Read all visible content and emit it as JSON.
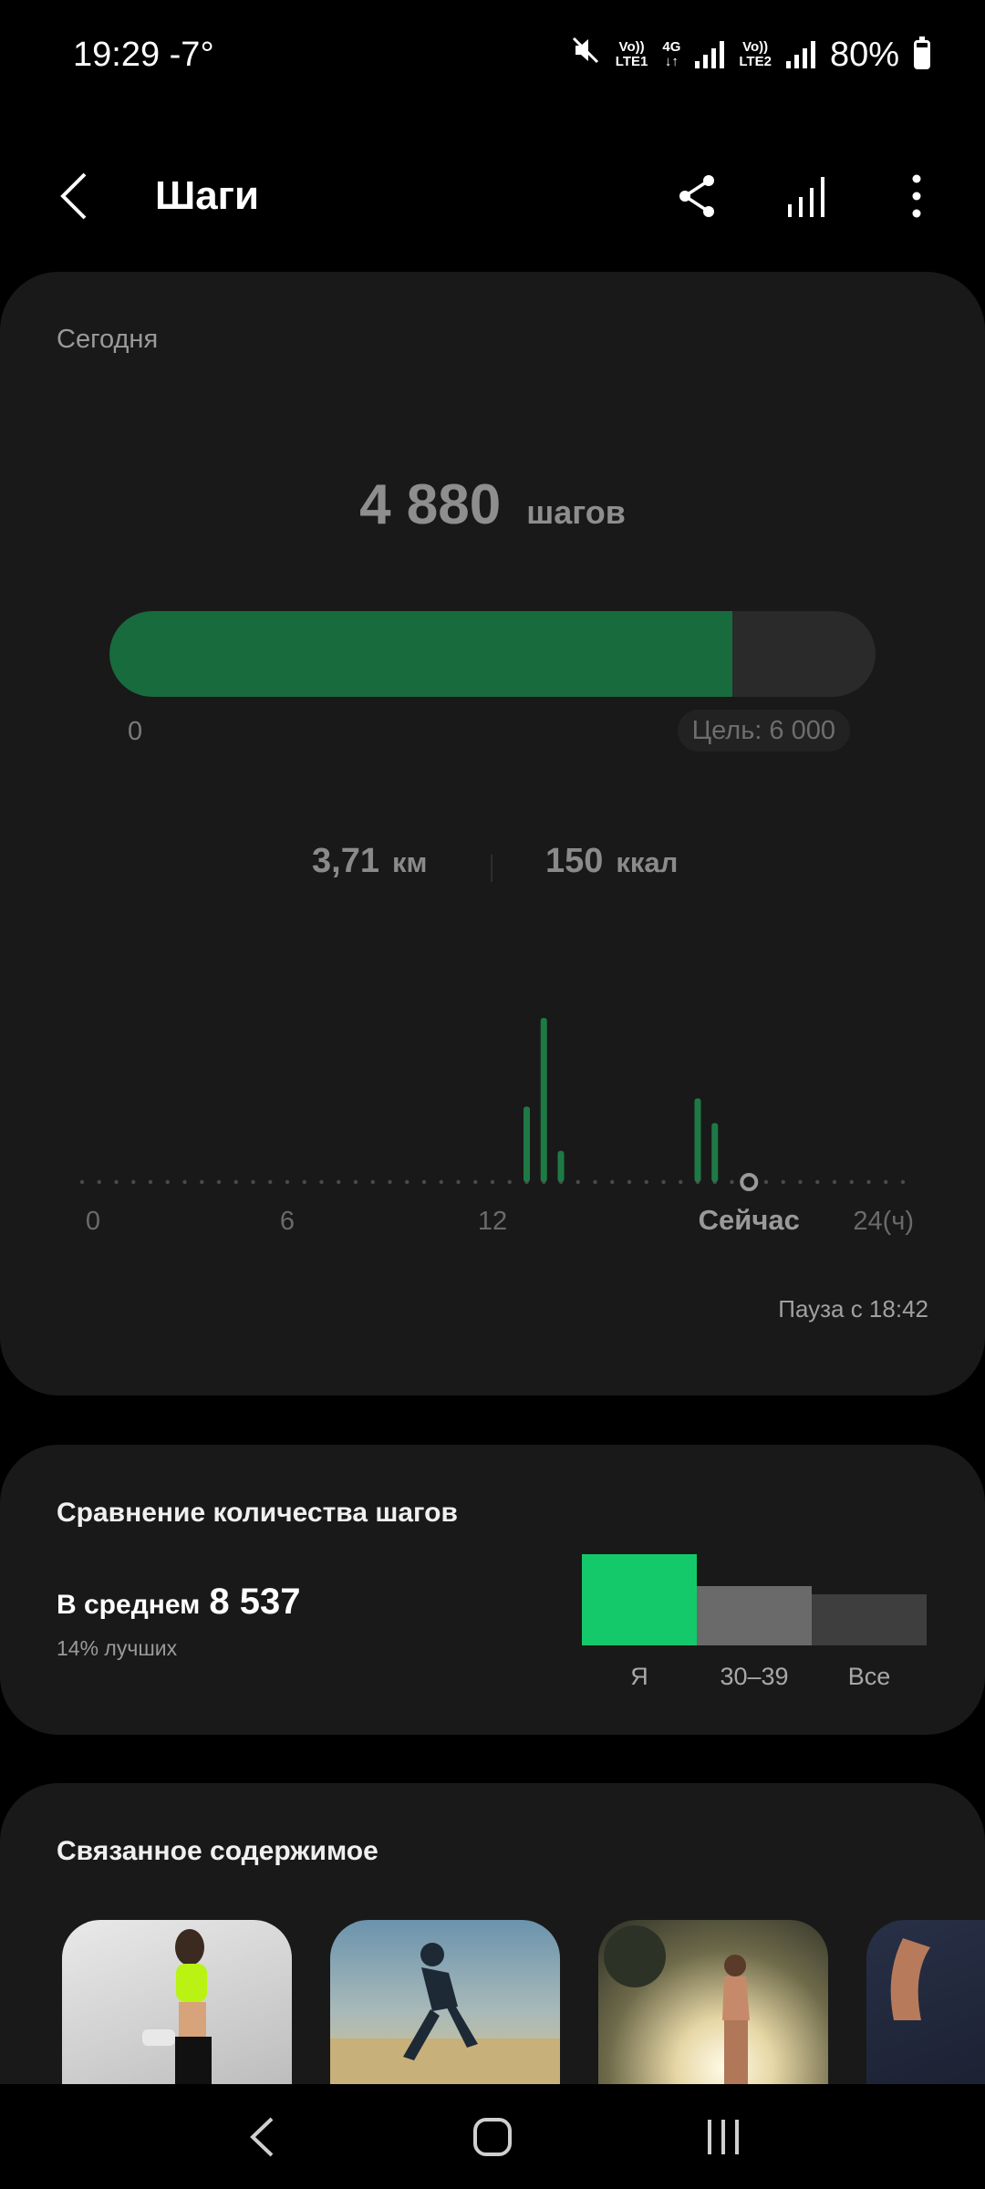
{
  "status_bar": {
    "time": "19:29",
    "temperature": "-7°",
    "sim1_top": "Vo))",
    "sim1_bottom": "LTE1",
    "network": "4G",
    "sim2_top": "Vo))",
    "sim2_bottom": "LTE2",
    "battery": "80%",
    "icons": [
      "mute-icon",
      "signal-icon",
      "battery-icon"
    ]
  },
  "header": {
    "title": "Шаги",
    "icons": [
      "back-icon",
      "share-icon",
      "stats-icon",
      "more-icon"
    ]
  },
  "today": {
    "label": "Сегодня",
    "steps_value": "4 880",
    "steps_unit": "шагов",
    "progress_fraction": 0.813,
    "progress_start": "0",
    "goal": "Цель: 6 000",
    "distance_value": "3,71",
    "distance_unit": "км",
    "calories_value": "150",
    "calories_unit": "ккал",
    "pause_note": "Пауза с 18:42",
    "accent_color": "#176b3d"
  },
  "chart_data": {
    "type": "bar",
    "x_ticks": [
      "0",
      "6",
      "12",
      "Сейчас",
      "24(ч)"
    ],
    "now_hour": 19.5,
    "bars": [
      {
        "hour": 13.0,
        "value": 0.46
      },
      {
        "hour": 13.5,
        "value": 1.0
      },
      {
        "hour": 14.0,
        "value": 0.19
      },
      {
        "hour": 18.0,
        "value": 0.51
      },
      {
        "hour": 18.5,
        "value": 0.36
      }
    ],
    "ylim": [
      0,
      1
    ],
    "grid": false,
    "bar_color": "#1e7a45"
  },
  "comparison": {
    "title": "Сравнение количества шагов",
    "avg_label": "В среднем",
    "avg_value": "8 537",
    "sub": "14% лучших",
    "bars": [
      {
        "label": "Я",
        "value": 1.0,
        "color": "#14c96a"
      },
      {
        "label": "30–39",
        "value": 0.65,
        "color": "#6a6a6a"
      },
      {
        "label": "Все",
        "value": 0.56,
        "color": "#3e3e3e"
      }
    ]
  },
  "related": {
    "title": "Связанное содержимое",
    "items": [
      "fitness-photo",
      "running-photo",
      "jogging-photo",
      "arm-photo"
    ]
  },
  "navbar": {
    "icons": [
      "nav-back-icon",
      "nav-home-icon",
      "nav-recents-icon"
    ]
  }
}
